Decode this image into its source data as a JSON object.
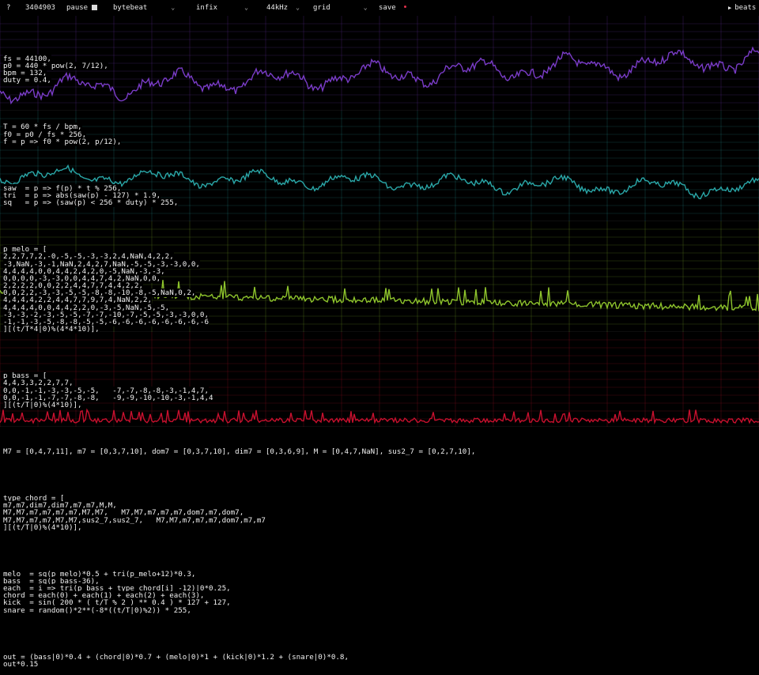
{
  "toolbar": {
    "help": "?",
    "time": "3404903",
    "pause": "pause",
    "mode": "bytebeat",
    "syntax": "infix",
    "rate": "44kHz",
    "view": "grid",
    "save": "save",
    "beats": "beats"
  },
  "colors": {
    "purple": "#7a3cc8",
    "teal": "#2aa7a8",
    "green": "#8ec42c",
    "red": "#c8102e",
    "grid": "#3a3a3a"
  },
  "code": {
    "b1": [
      "fs = 44100,",
      "p0 = 440 * pow(2, 7/12),",
      "bpm = 132,",
      "duty = 0.4,"
    ],
    "b2": [
      "T = 60 * fs / bpm,",
      "f0 = p0 / fs * 256,",
      "f = p => f0 * pow(2, p/12),"
    ],
    "b3": [
      "saw  = p => f(p) * t % 256,",
      "tri  = p => abs(saw(p) - 127) * 1.9,",
      "sq   = p => (saw(p) < 256 * duty) * 255,"
    ],
    "b4": [
      "p_melo = [",
      "2,2,7,7,2,-0,-5,-5,-3,-3,2,4,NaN,4,2,2,",
      "-3,NaN,-3,-1,NaN,2,4,2,7,NaN,-5,-5,-3,-3,0,0,",
      "4,4,4,4,0,0,4,4,2,4,2,0,-5,NaN,-3,-3,",
      "0,0,0,0,-3,-3,0,0,4,4,7,4,2,NaN,0,0,",
      "2,2,2,2,0,0,2,2,4,4,7,7,4,4,2,2,",
      "0,0,2,2,-3,-3,-5,-5,-8,-8,-10,-8,-5,NaN,0,2,",
      "4,4,4,4,2,2,4,4,7,7,9,7,4,NaN,2,2,",
      "4,4,4,4,0,0,4,4,2,2,0,-3,-5,NaN,-5,-5,",
      "-3,-3,-2,-3,-5,-5,-7,-7,-10,-7,-5,-5,-3,-3,0,0,",
      "-1,-1,-3,-5,-8,-8,-5,-5,-6,-6,-6,-6,-6,-6,-6,-6",
      "][(t/T*4|0)%(4*4*10)],"
    ],
    "b5": [
      "p_bass = [",
      "4,4,3,3,2,2,7,7,",
      "0,0,-1,-1,-3,-3,-5,-5,   -7,-7,-8,-8,-3,-1,4,7,",
      "0,0,-1,-1,-7,-7,-8,-8,   -9,-9,-10,-10,-3,-1,4,4",
      "][(t/T|0)%(4*10)],"
    ],
    "b6": [
      "M7 = [0,4,7,11], m7 = [0,3,7,10], dom7 = [0,3,7,10], dim7 = [0,3,6,9], M = [0,4,7,NaN], sus2_7 = [0,2,7,10],"
    ],
    "b7": [
      "type_chord = [",
      "m7,m7,dim7,dim7,m7,m7,M,M,",
      "M7,M7,m7,m7,m7,m7,M7,M7,   M7,M7,m7,m7,m7,dom7,m7,dom7,",
      "M7,M7,m7,m7,M7,M7,sus2_7,sus2_7,   M7,M7,m7,m7,m7,dom7,m7,m7",
      "][(t/T|0)%(4*10)],"
    ],
    "b8": [
      "melo  = sq(p_melo)*0.5 + tri(p_melo+12)*0.3,",
      "bass  = sq(p_bass-36),",
      "each  = i => tri(p_bass + type_chord[i] -12)|0*0.25,",
      "chord = each(0) + each(1) + each(2) + each(3),",
      "kick  = sin( 200 * ( t/T % 2 ) ** 0.4 ) * 127 + 127,",
      "snare = random()*2**(-8*((t/T|0)%2)) * 255,"
    ],
    "b9": [
      "out = (bass|0)*0.4 + (chord|0)*0.7 + (melo|0)*1 + (kick|0)*1.2 + (snare|0)*0.8,",
      "out*0.15"
    ]
  }
}
